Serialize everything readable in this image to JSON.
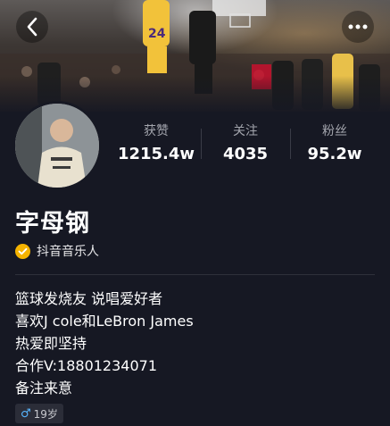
{
  "header": {
    "banner_icon": "basketball-photo-banner",
    "back_icon": "chevron-left-icon",
    "more_icon": "more-dots-icon",
    "jersey_number": "24"
  },
  "profile": {
    "name": "字母钢",
    "verification": "抖音音乐人",
    "verification_color": "#f5b300"
  },
  "stats": [
    {
      "label": "获赞",
      "value": "1215.4w"
    },
    {
      "label": "关注",
      "value": "4035"
    },
    {
      "label": "粉丝",
      "value": "95.2w"
    }
  ],
  "bio": [
    "篮球发烧友 说唱爱好者",
    "喜欢J cole和LeBron James",
    "热爱即坚持",
    "合作V:18801234071",
    "备注来意"
  ],
  "tags": {
    "gender_icon": "male-icon",
    "gender_symbol": "♂",
    "age": "19岁",
    "gender_color": "#58b6ff"
  },
  "colors": {
    "background": "#161823",
    "secondary_text": "#a3a5ad"
  }
}
